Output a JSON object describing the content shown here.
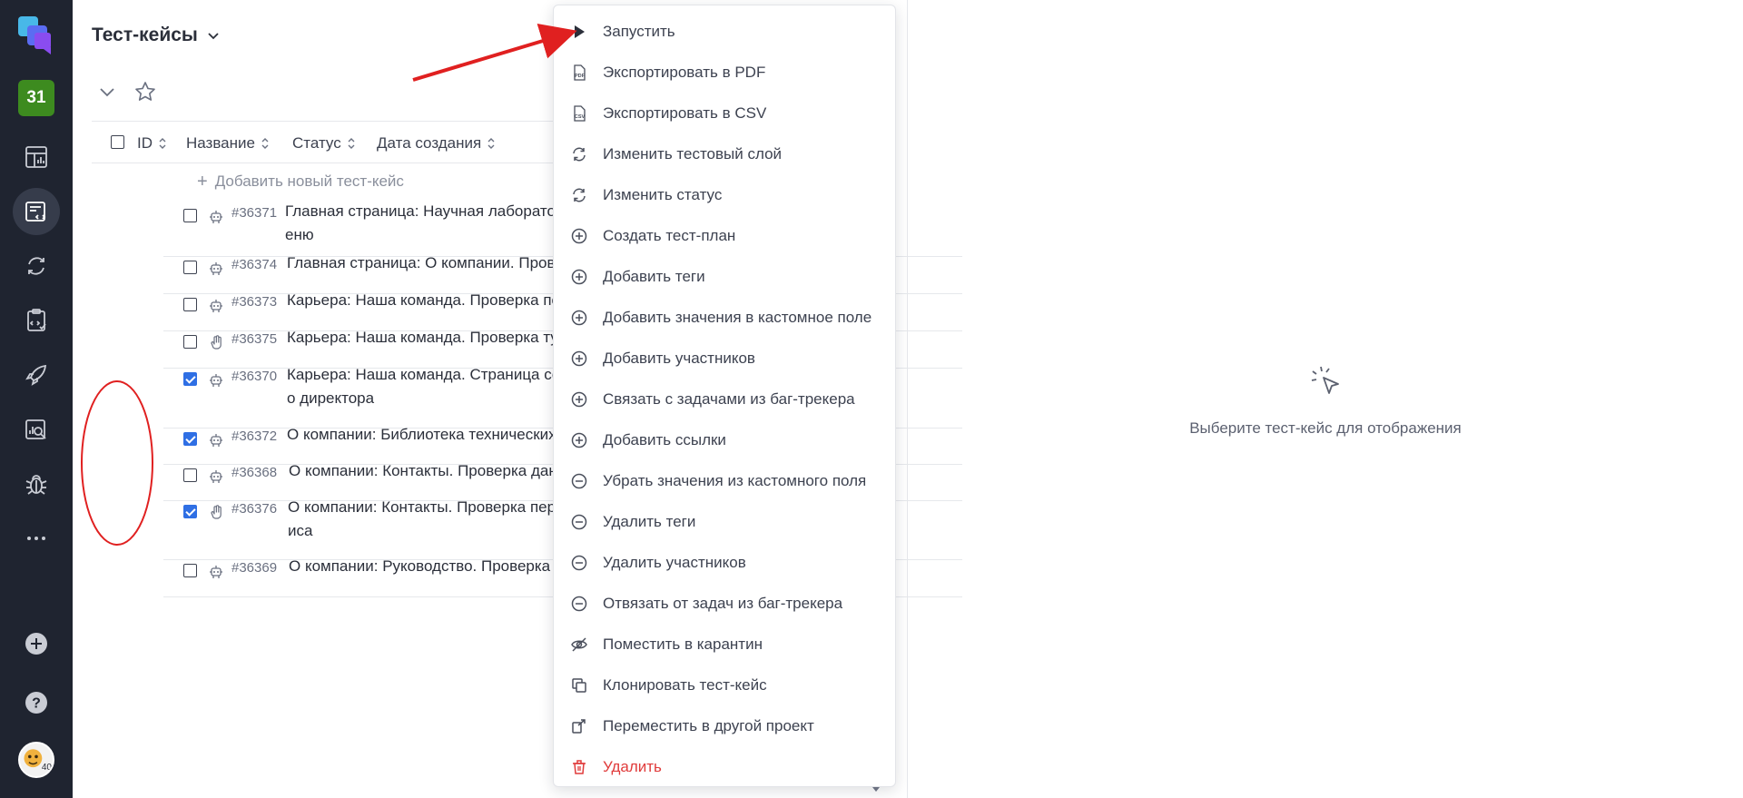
{
  "rail": {
    "project_badge": "31",
    "avatar_badge": "40",
    "items": [
      {
        "name": "dashboard-icon"
      },
      {
        "name": "test-cases-icon",
        "active": true
      },
      {
        "name": "test-runs-icon"
      },
      {
        "name": "test-plans-icon"
      },
      {
        "name": "launches-icon"
      },
      {
        "name": "analytics-icon"
      },
      {
        "name": "defects-icon"
      },
      {
        "name": "more-icon"
      }
    ]
  },
  "header": {
    "title": "Тест-кейсы"
  },
  "table": {
    "columns": [
      "ID",
      "Название",
      "Статус",
      "Дата создания"
    ],
    "add_label": "Добавить новый тест-кейс",
    "rows": [
      {
        "id": "#36371",
        "title": "Главная страница: Научная лаборатория. Проп",
        "title2": "еню",
        "checked": false,
        "type": "automated"
      },
      {
        "id": "#36374",
        "title": "Главная страница: О компании. Проверка пун",
        "title2": "",
        "checked": false,
        "type": "automated"
      },
      {
        "id": "#36373",
        "title": "Карьера: Наша команда. Проверка полей фор",
        "title2": "",
        "checked": false,
        "type": "automated"
      },
      {
        "id": "#36375",
        "title": "Карьера: Наша команда. Проверка тултипа в",
        "title2": "",
        "checked": false,
        "type": "manual"
      },
      {
        "id": "#36370",
        "title": "Карьера: Наша команда. Страница содержит",
        "title2": "о директора",
        "checked": true,
        "type": "automated"
      },
      {
        "id": "#36372",
        "title": "О компании: Библиотека технических задани",
        "title2": "",
        "checked": true,
        "type": "automated"
      },
      {
        "id": "#36368",
        "title": "О компании: Контакты. Проверка данных офи",
        "title2": "",
        "checked": false,
        "type": "automated"
      },
      {
        "id": "#36376",
        "title": "О компании: Контакты. Проверка перехода на",
        "title2": "иса",
        "checked": true,
        "type": "manual"
      },
      {
        "id": "#36369",
        "title": "О компании: Руководство. Проверка отображ",
        "title2": "",
        "checked": false,
        "type": "automated"
      }
    ]
  },
  "detail": {
    "empty_text": "Выберите тест-кейс для отображения"
  },
  "menu": {
    "items": [
      {
        "label": "Запустить",
        "icon": "play-icon"
      },
      {
        "label": "Экспортировать в PDF",
        "icon": "pdf-file-icon"
      },
      {
        "label": "Экспортировать в CSV",
        "icon": "csv-file-icon"
      },
      {
        "label": "Изменить тестовый слой",
        "icon": "refresh-icon"
      },
      {
        "label": "Изменить статус",
        "icon": "refresh-icon"
      },
      {
        "label": "Создать тест-план",
        "icon": "plus-circle-icon"
      },
      {
        "label": "Добавить теги",
        "icon": "plus-circle-icon"
      },
      {
        "label": "Добавить значения в кастомное поле",
        "icon": "plus-circle-icon"
      },
      {
        "label": "Добавить участников",
        "icon": "plus-circle-icon"
      },
      {
        "label": "Связать с задачами из баг-трекера",
        "icon": "plus-circle-icon"
      },
      {
        "label": "Добавить ссылки",
        "icon": "plus-circle-icon"
      },
      {
        "label": "Убрать значения из кастомного поля",
        "icon": "minus-circle-icon"
      },
      {
        "label": "Удалить теги",
        "icon": "minus-circle-icon"
      },
      {
        "label": "Удалить участников",
        "icon": "minus-circle-icon"
      },
      {
        "label": "Отвязать от задач из баг-трекера",
        "icon": "minus-circle-icon"
      },
      {
        "label": "Поместить в карантин",
        "icon": "eye-off-icon"
      },
      {
        "label": "Клонировать тест-кейс",
        "icon": "copy-icon"
      },
      {
        "label": "Переместить в другой проект",
        "icon": "move-icon"
      },
      {
        "label": "Удалить",
        "icon": "trash-icon",
        "danger": true
      }
    ]
  },
  "colors": {
    "rail_bg": "#1f2430",
    "accent": "#2f6fe4",
    "danger": "#e03b3b",
    "project_badge": "#3d8b1f",
    "annotation": "#e02020"
  }
}
